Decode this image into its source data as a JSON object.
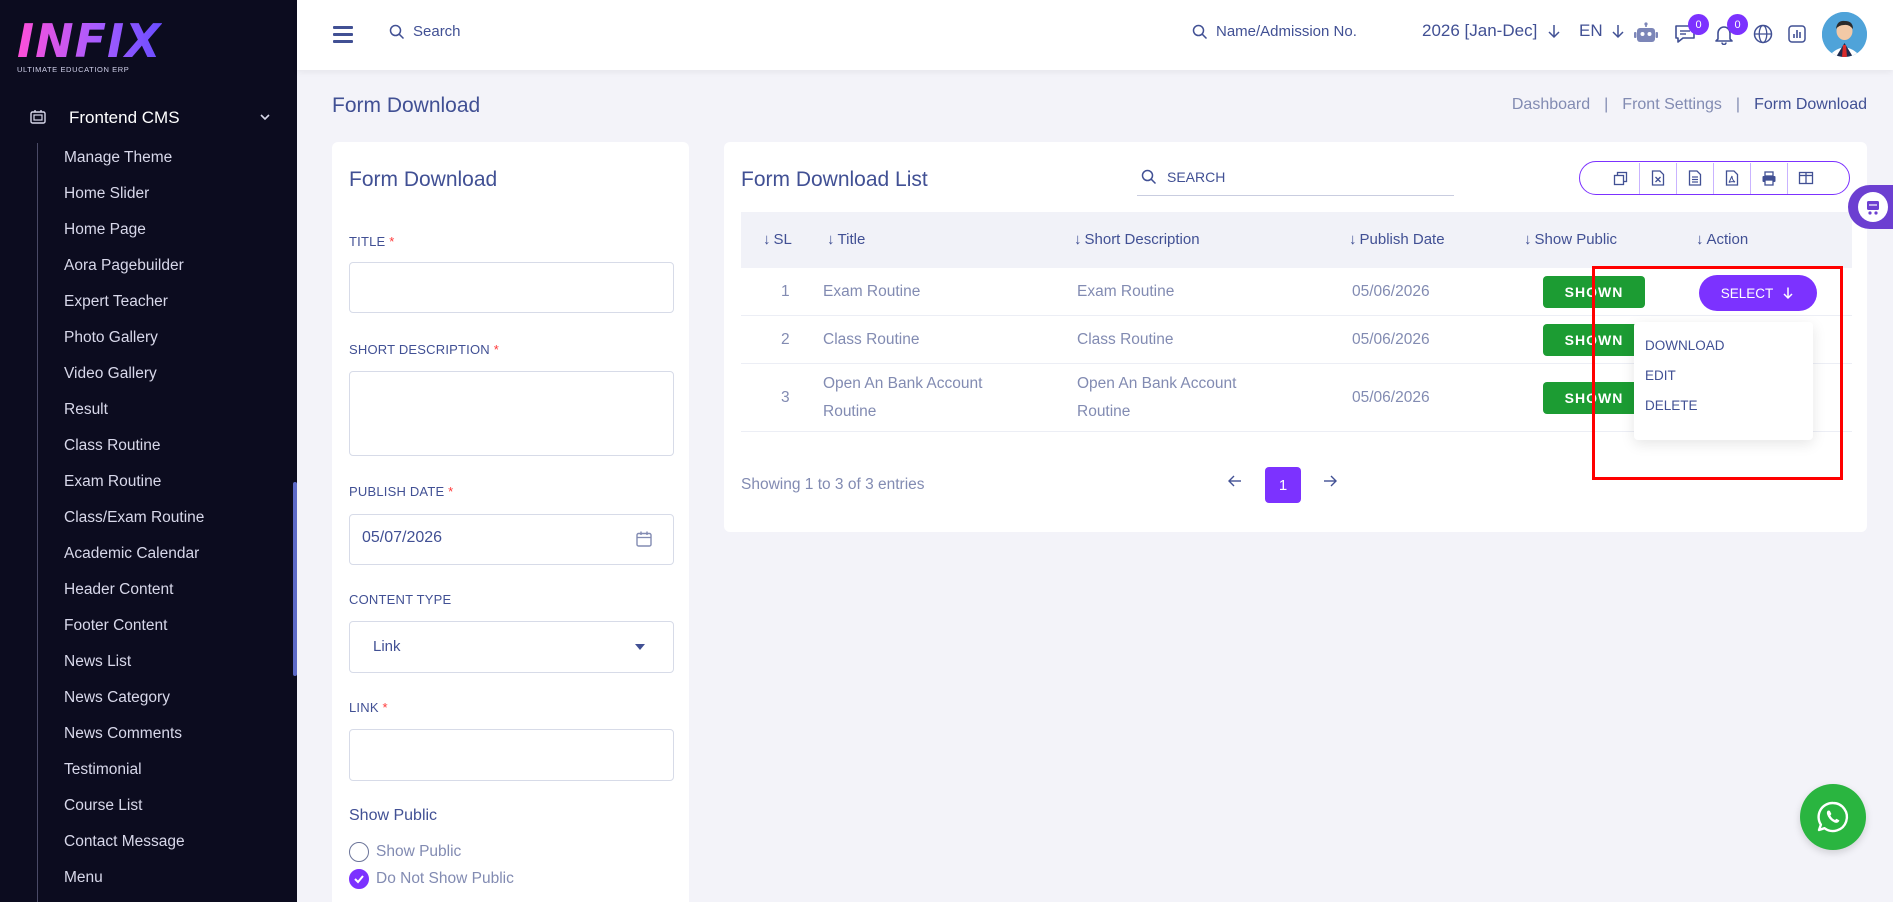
{
  "brand": {
    "logo_text": "INFIX",
    "tagline": "ULTIMATE EDUCATION ERP"
  },
  "sidebar": {
    "section_label": "Frontend CMS",
    "items": [
      {
        "label": "Manage Theme"
      },
      {
        "label": "Home Slider"
      },
      {
        "label": "Home Page"
      },
      {
        "label": "Aora Pagebuilder"
      },
      {
        "label": "Expert Teacher"
      },
      {
        "label": "Photo Gallery"
      },
      {
        "label": "Video Gallery"
      },
      {
        "label": "Result"
      },
      {
        "label": "Class Routine"
      },
      {
        "label": "Exam Routine"
      },
      {
        "label": "Class/Exam Routine"
      },
      {
        "label": "Academic Calendar"
      },
      {
        "label": "Header Content"
      },
      {
        "label": "Footer Content"
      },
      {
        "label": "News List"
      },
      {
        "label": "News Category"
      },
      {
        "label": "News Comments"
      },
      {
        "label": "Testimonial"
      },
      {
        "label": "Course List"
      },
      {
        "label": "Contact Message"
      },
      {
        "label": "Menu"
      }
    ]
  },
  "header": {
    "search_label": "Search",
    "admission_search_label": "Name/Admission No.",
    "session": "2026 [Jan-Dec]",
    "language": "EN",
    "chat_count": "0",
    "notification_count": "0"
  },
  "page": {
    "title": "Form Download",
    "breadcrumb": [
      "Dashboard",
      "Front Settings",
      "Form Download"
    ],
    "breadcrumb_sep": "|"
  },
  "form": {
    "title": "Form Download",
    "title_label": "TITLE",
    "short_description_label": "SHORT DESCRIPTION",
    "publish_date_label": "PUBLISH DATE",
    "publish_date_value": "05/07/2026",
    "content_type_label": "CONTENT TYPE",
    "content_type_value": "Link",
    "link_label": "LINK",
    "required_mark": "*",
    "show_public_label": "Show Public",
    "radio_show": "Show Public",
    "radio_hide": "Do Not Show Public"
  },
  "list": {
    "title": "Form Download List",
    "search_label": "SEARCH",
    "export_icons": [
      "copy-icon",
      "excel-icon",
      "csv-icon",
      "pdf-icon",
      "print-icon",
      "columns-icon"
    ],
    "columns": [
      "SL",
      "Title",
      "Short Description",
      "Publish Date",
      "Show Public",
      "Action"
    ],
    "sort_arrow": "↓",
    "rows": [
      {
        "sl": "1",
        "title": "Exam Routine",
        "short_description": "Exam Routine",
        "publish_date": "05/06/2026",
        "status": "SHOWN"
      },
      {
        "sl": "2",
        "title": "Class Routine",
        "short_description": "Class Routine",
        "publish_date": "05/06/2026",
        "status": "SHOWN"
      },
      {
        "sl": "3",
        "title": "Open An Bank Account Routine",
        "short_description": "Open An Bank Account Routine",
        "publish_date": "05/06/2026",
        "status": "SHOWN"
      }
    ],
    "select_label": "SELECT",
    "dropdown_items": [
      "DOWNLOAD",
      "EDIT",
      "DELETE"
    ],
    "pagination_info": "Showing 1 to 3 of 3 entries",
    "current_page": "1"
  },
  "colors": {
    "accent": "#7c32ff",
    "sidebar_bg": "#0c0c1f",
    "shown_badge": "#1c9c33",
    "whatsapp": "#2ab540",
    "annotation_box": "#ff0000"
  }
}
